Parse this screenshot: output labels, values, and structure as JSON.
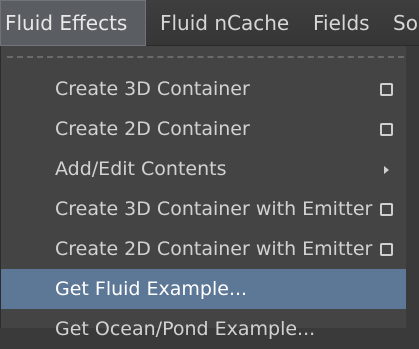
{
  "menubar": {
    "items": [
      {
        "label": "Fluid Effects",
        "active": true
      },
      {
        "label": "Fluid nCache",
        "active": false
      },
      {
        "label": "Fields",
        "active": false
      },
      {
        "label": "So",
        "active": false
      }
    ]
  },
  "menu": {
    "items": [
      {
        "label": "Create 3D Container",
        "indicator": "option-box"
      },
      {
        "label": "Create 2D Container",
        "indicator": "option-box"
      },
      {
        "label": "Add/Edit Contents",
        "indicator": "submenu-arrow"
      },
      {
        "label": "Create 3D Container with Emitter",
        "indicator": "option-box"
      },
      {
        "label": "Create 2D Container with Emitter",
        "indicator": "option-box"
      },
      {
        "label": "Get Fluid Example...",
        "indicator": "none",
        "highlighted": true
      },
      {
        "label": "Get Ocean/Pond Example...",
        "indicator": "none"
      }
    ]
  },
  "colors": {
    "menu_background": "#444444",
    "highlight": "#5d7796",
    "text": "#d2d2d2"
  }
}
